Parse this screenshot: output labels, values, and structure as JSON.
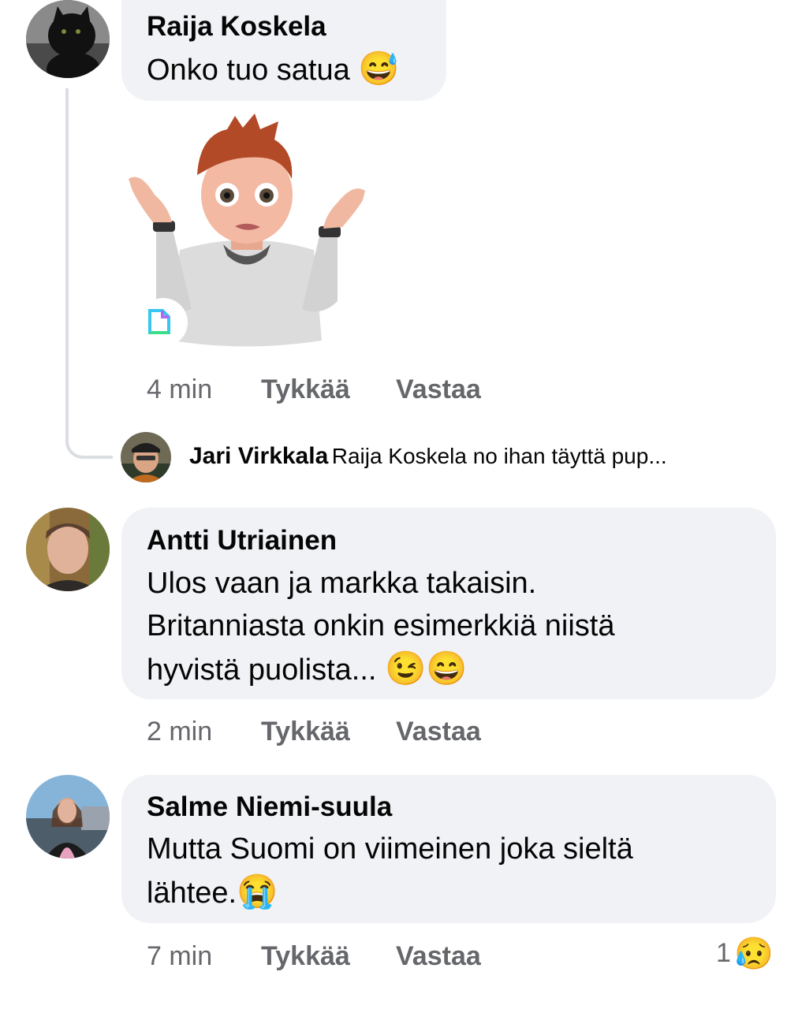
{
  "comments": [
    {
      "author": "Raija Koskela",
      "text": "Onko tuo satua",
      "emoji": "😅",
      "time": "4 min",
      "like_label": "Tykkää",
      "reply_label": "Vastaa"
    },
    {
      "author": "Antti Utriainen",
      "text_lines": [
        "Ulos vaan ja markka takaisin.",
        "Britanniasta onkin esimerkkiä niistä",
        "hyvistä puolista..."
      ],
      "emoji": "😉😄",
      "time": "2 min",
      "like_label": "Tykkää",
      "reply_label": "Vastaa"
    },
    {
      "author": "Salme Niemi-suula",
      "text_lines": [
        "Mutta Suomi on viimeinen joka sieltä",
        "lähtee."
      ],
      "emoji": "😭",
      "time": "7 min",
      "like_label": "Tykkää",
      "reply_label": "Vastaa",
      "reaction_count": "1",
      "reaction_emoji": "😥"
    }
  ],
  "reply_preview": {
    "author": "Jari Virkkala",
    "text": "Raija Koskela no ihan täyttä pup..."
  }
}
